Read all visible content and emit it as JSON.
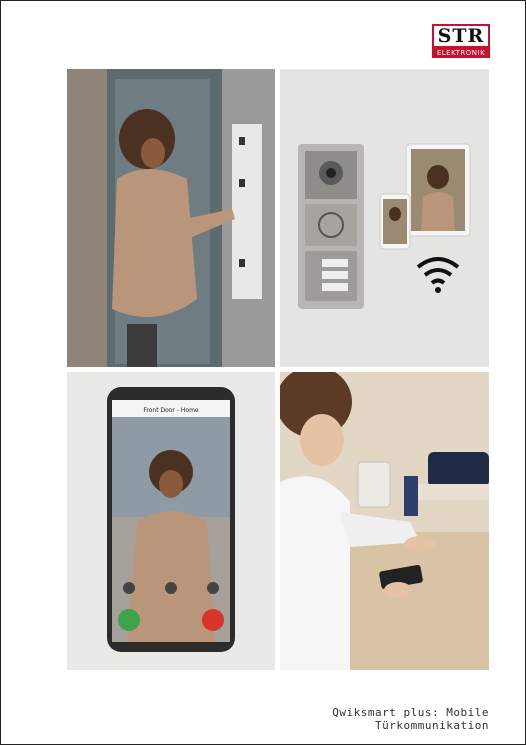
{
  "logo": {
    "top": "STR",
    "bottom": "ELEKTRONIK",
    "brand_color": "#c8102e"
  },
  "caption": "Qwiksmart plus: Mobile Türkommunikation",
  "phone": {
    "app_title": "Front Door - Home"
  }
}
